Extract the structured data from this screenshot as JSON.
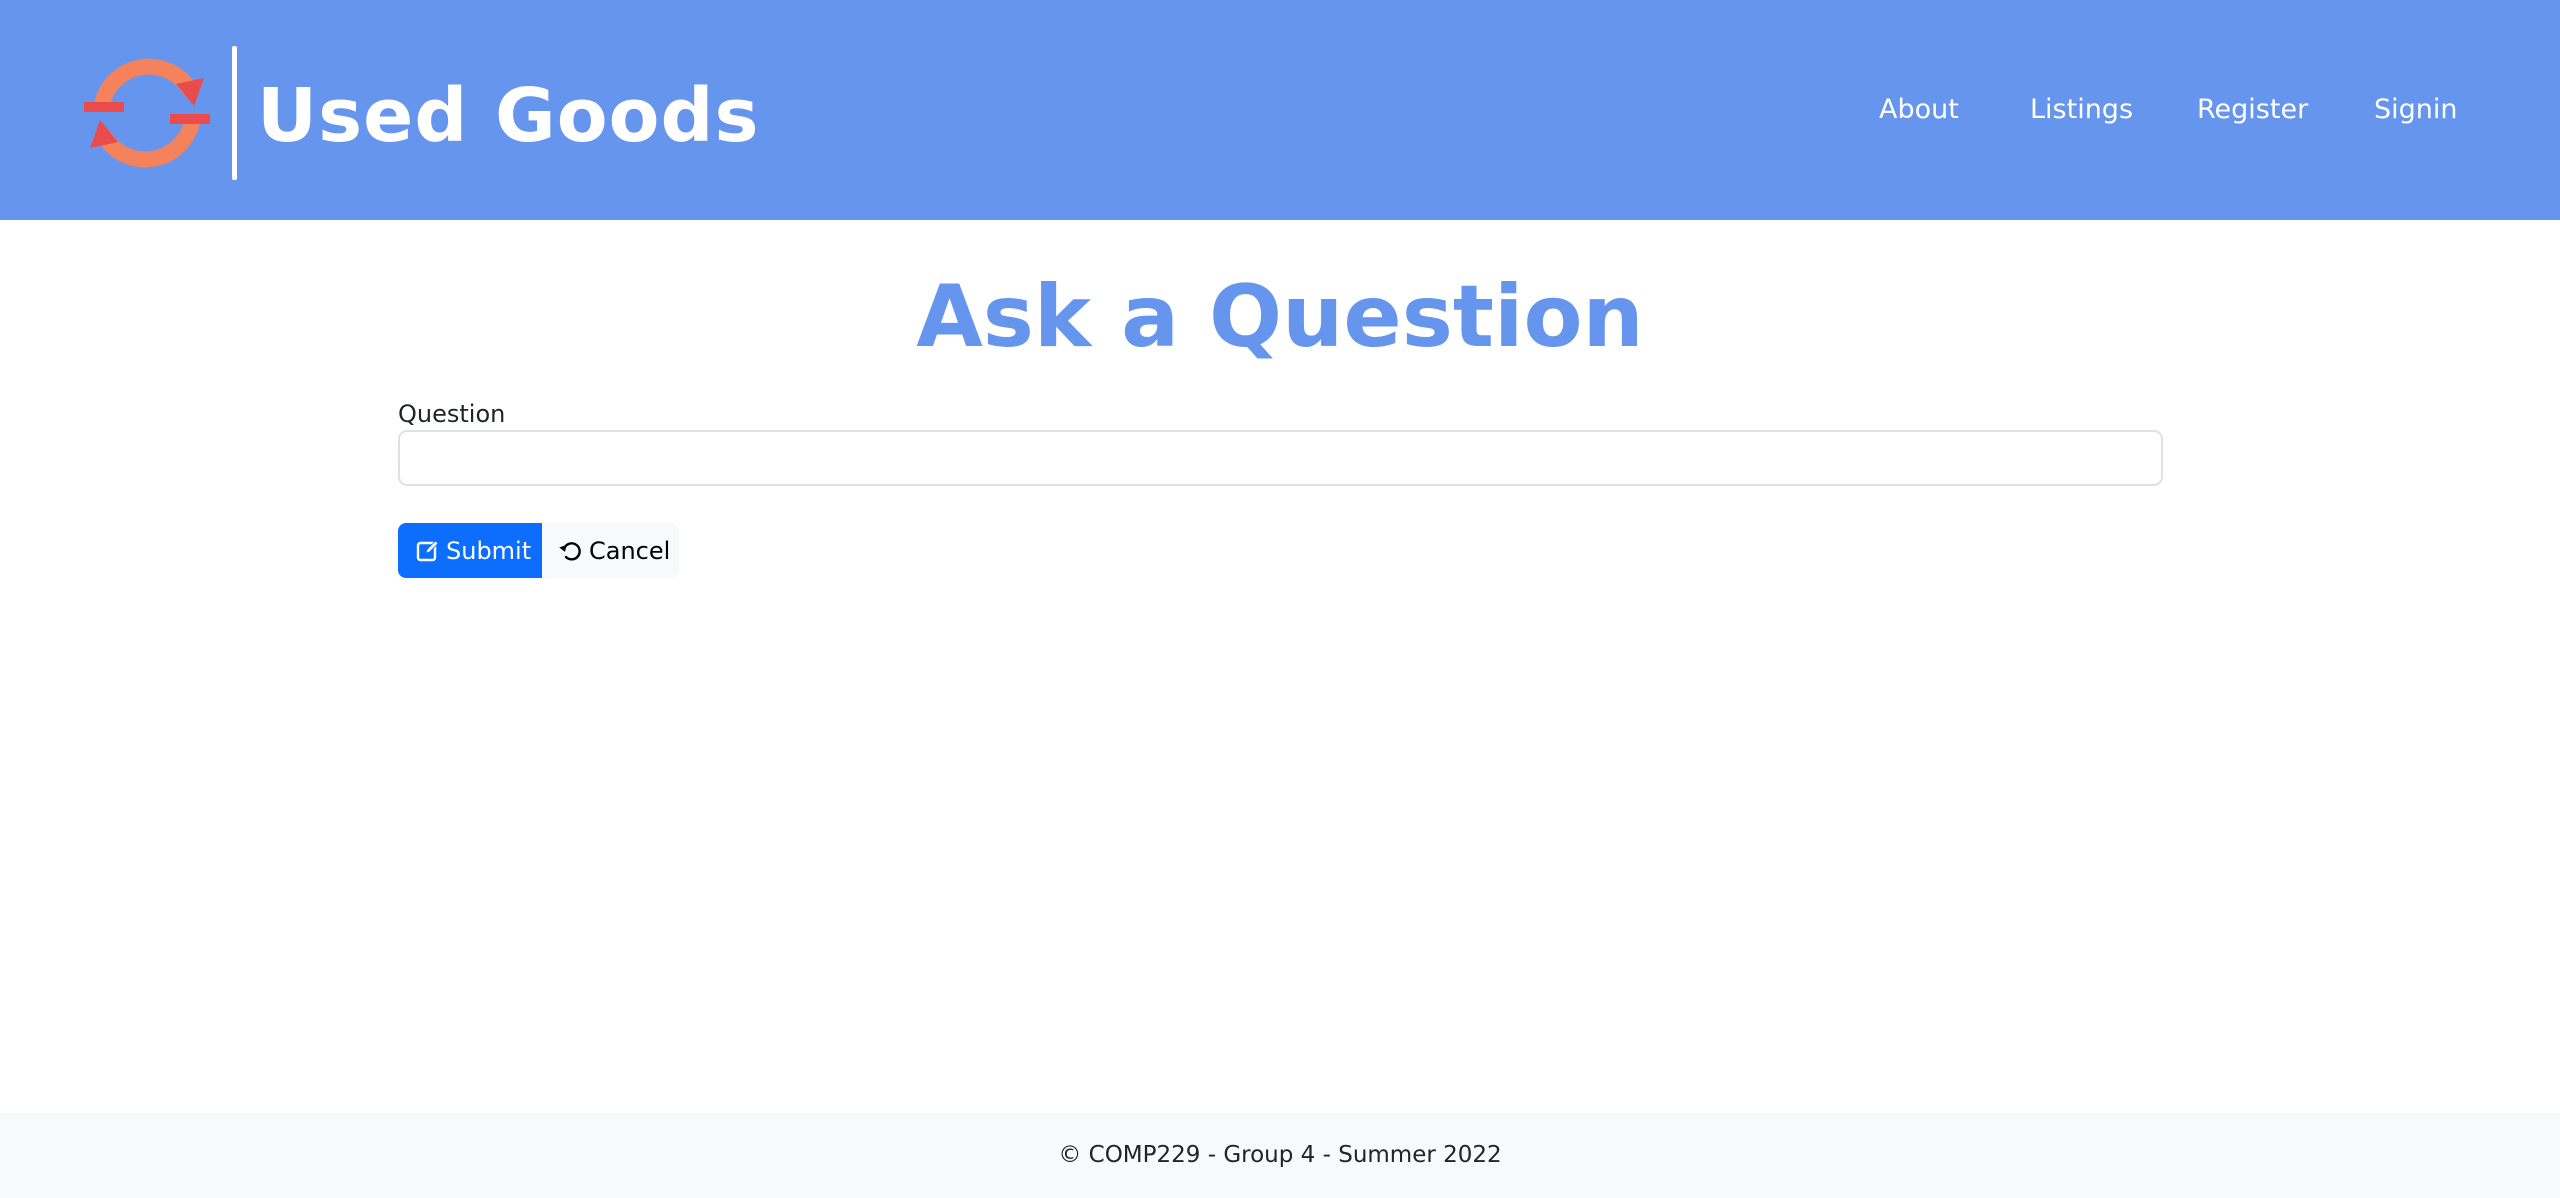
{
  "header": {
    "brand": "Used Goods",
    "logo_icon": "recycle-arrows-icon",
    "nav": [
      {
        "label": "About"
      },
      {
        "label": "Listings"
      },
      {
        "label": "Register"
      },
      {
        "label": "Signin"
      }
    ]
  },
  "main": {
    "title": "Ask a Question",
    "form": {
      "question_label": "Question",
      "question_value": "",
      "question_placeholder": "",
      "submit_label": "Submit",
      "submit_icon": "edit-icon",
      "cancel_label": "Cancel",
      "cancel_icon": "undo-icon"
    }
  },
  "footer": {
    "text": "© COMP229 - Group 4 - Summer 2022"
  },
  "colors": {
    "header_bg": "#6695ed",
    "title": "#6695ed",
    "logo_orange": "#f4825c",
    "logo_red": "#ea4c4c",
    "submit_bg": "#0d6efd",
    "cancel_bg": "#f8f9fa",
    "footer_bg": "#f8f9fa"
  }
}
